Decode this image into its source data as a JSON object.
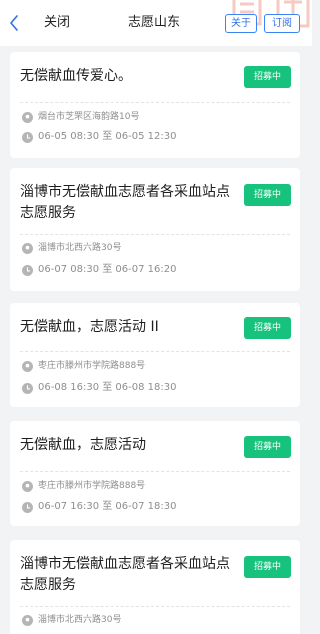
{
  "navbar": {
    "close_label": "关闭",
    "title": "志愿山东",
    "about_label": "关于",
    "subscribe_label": "订阅"
  },
  "colors": {
    "accent": "#2f6fe8",
    "badge": "#16c27c",
    "background": "#f2f3f5"
  },
  "activities": [
    {
      "title": "无偿献血传爱心。",
      "status": "招募中",
      "address": "烟台市芝罘区海韵路10号",
      "time": "06-05 08:30 至 06-05 12:30"
    },
    {
      "title": "淄博市无偿献血志愿者各采血站点志愿服务",
      "status": "招募中",
      "address": "淄博市北西六路30号",
      "time": "06-07 08:30 至 06-07 16:20"
    },
    {
      "title": "无偿献血，志愿活动 II",
      "status": "招募中",
      "address": "枣庄市滕州市学院路888号",
      "time": "06-08 16:30 至 06-08 18:30"
    },
    {
      "title": "无偿献血，志愿活动",
      "status": "招募中",
      "address": "枣庄市滕州市学院路888号",
      "time": "06-07 16:30 至 06-07 18:30"
    },
    {
      "title": "淄博市无偿献血志愿者各采血站点志愿服务",
      "status": "招募中",
      "address": "淄博市北西六路30号",
      "time": ""
    }
  ]
}
